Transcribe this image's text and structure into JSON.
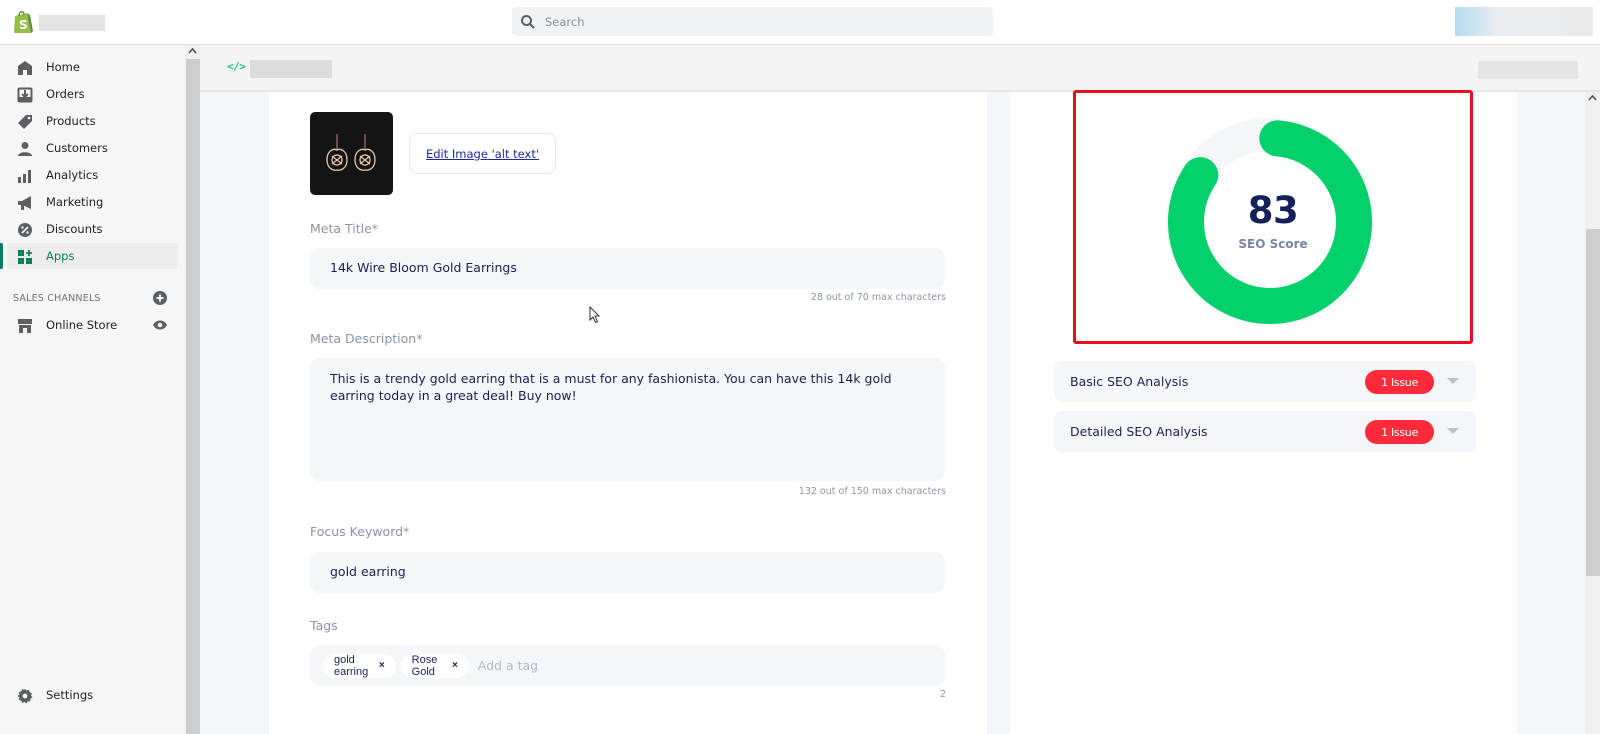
{
  "topbar": {
    "search_placeholder": "Search"
  },
  "sidebar": {
    "items": [
      {
        "label": "Home",
        "icon": "home-icon"
      },
      {
        "label": "Orders",
        "icon": "orders-icon"
      },
      {
        "label": "Products",
        "icon": "tag-icon"
      },
      {
        "label": "Customers",
        "icon": "person-icon"
      },
      {
        "label": "Analytics",
        "icon": "bar-chart-icon"
      },
      {
        "label": "Marketing",
        "icon": "megaphone-icon"
      },
      {
        "label": "Discounts",
        "icon": "discount-icon"
      },
      {
        "label": "Apps",
        "icon": "apps-icon",
        "active": true
      }
    ],
    "sales_channels_title": "SALES CHANNELS",
    "channels": [
      {
        "label": "Online Store",
        "icon": "store-icon"
      }
    ],
    "settings_label": "Settings"
  },
  "app_header": {
    "icon": "code-icon",
    "icon_text": "</>"
  },
  "form": {
    "edit_alt_text_label": "Edit Image 'alt text'",
    "meta_title": {
      "label": "Meta Title*",
      "value": "14k Wire Bloom Gold Earrings",
      "counter": "28 out of 70 max characters"
    },
    "meta_description": {
      "label": "Meta Description*",
      "value": "This is a trendy gold earring that is a must for any fashionista. You can have this 14k gold earring today in a great deal! Buy now!",
      "counter": "132 out of 150 max characters"
    },
    "focus_keyword": {
      "label": "Focus Keyword*",
      "value": "gold earring"
    },
    "tags": {
      "label": "Tags",
      "items": [
        "gold earring",
        "Rose Gold"
      ],
      "remove_glyph": "×",
      "placeholder": "Add a tag",
      "count": "2"
    }
  },
  "seo": {
    "score": 83,
    "score_text": "83",
    "score_label": "SEO Score",
    "score_color": "#02d16b",
    "highlight_color": "#e8101e",
    "analyses": [
      {
        "label": "Basic SEO Analysis",
        "badge": "1 Issue"
      },
      {
        "label": "Detailed SEO Analysis",
        "badge": "1 Issue"
      }
    ],
    "badge_color": "#ff2b3b"
  }
}
